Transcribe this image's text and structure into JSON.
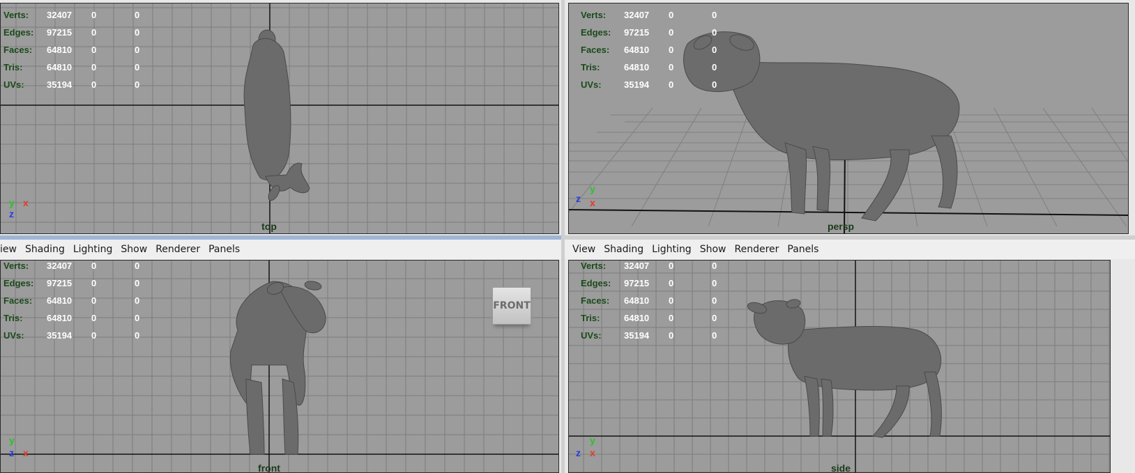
{
  "stats": {
    "labels": [
      "Verts:",
      "Edges:",
      "Faces:",
      "Tris:",
      "UVs:"
    ],
    "rows": [
      {
        "label": "Verts:",
        "a": "32407",
        "b": "0",
        "c": "0"
      },
      {
        "label": "Edges:",
        "a": "97215",
        "b": "0",
        "c": "0"
      },
      {
        "label": "Faces:",
        "a": "64810",
        "b": "0",
        "c": "0"
      },
      {
        "label": "Tris:",
        "a": "64810",
        "b": "0",
        "c": "0"
      },
      {
        "label": "UVs:",
        "a": "35194",
        "b": "0",
        "c": "0"
      }
    ]
  },
  "menu": {
    "bottom_left": [
      "iew",
      "Shading",
      "Lighting",
      "Show",
      "Renderer",
      "Panels"
    ],
    "bottom_right": [
      "View",
      "Shading",
      "Lighting",
      "Show",
      "Renderer",
      "Panels"
    ]
  },
  "viewports": {
    "top": {
      "camera": "top"
    },
    "persp": {
      "camera": "persp"
    },
    "front": {
      "camera": "front",
      "viewcube": "FRONT"
    },
    "side": {
      "camera": "side"
    }
  },
  "axes": {
    "x": "x",
    "y": "y",
    "z": "z"
  },
  "colors": {
    "viewport_bg": "#9c9c9c",
    "grid_line": "#7a7a7a",
    "axis_line": "#111111",
    "hud_label": "#1a4a1a",
    "hud_value": "#ffffff",
    "model": "#6a6a6a"
  }
}
